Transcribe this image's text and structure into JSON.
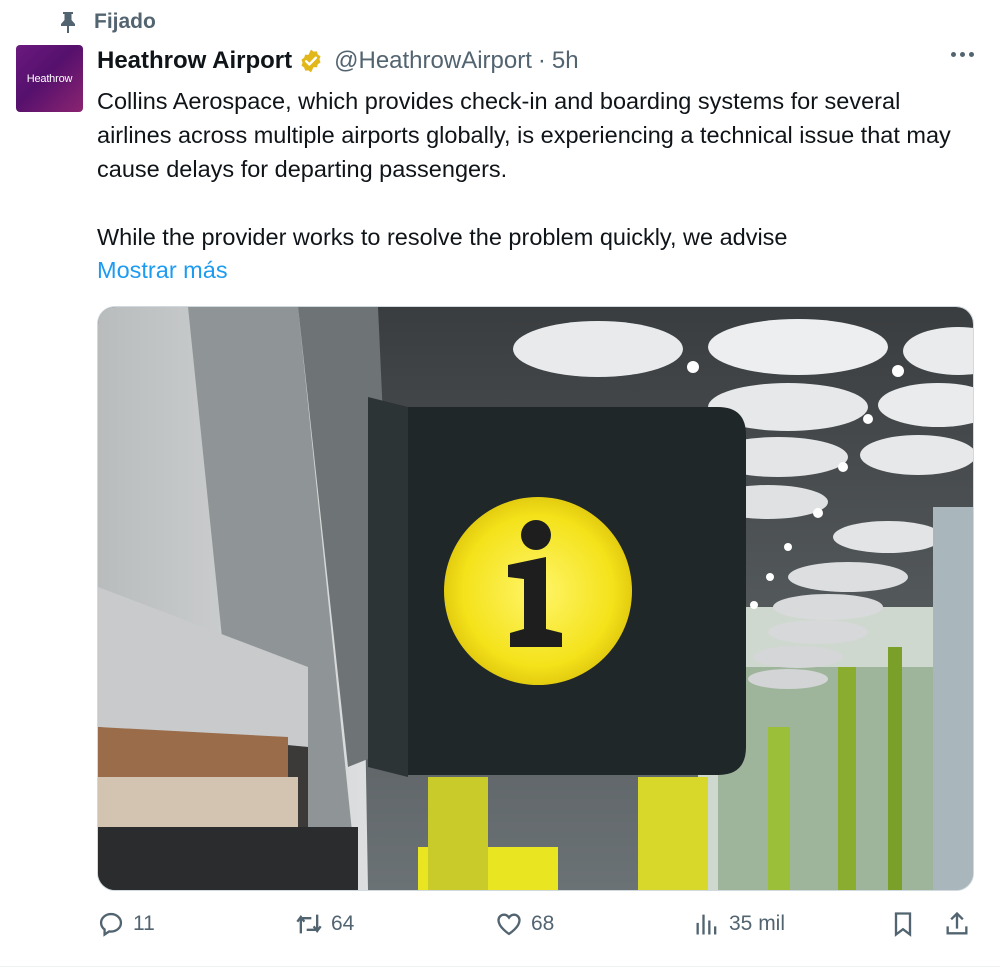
{
  "pinned_label": "Fijado",
  "author": {
    "avatar_text": "Heathrow",
    "name": "Heathrow Airport",
    "handle": "@HeathrowAirport",
    "separator": "·",
    "time": "5h"
  },
  "text": {
    "paragraph1": "Collins Aerospace, which provides check-in and boarding systems for several airlines across multiple airports globally, is experiencing a technical issue that may cause delays for departing passengers.",
    "paragraph2": "While the provider works to resolve the problem quickly, we advise",
    "show_more": "Mostrar más"
  },
  "media": {
    "icon": "information-sign-icon"
  },
  "actions": {
    "replies": "11",
    "reposts": "64",
    "likes": "68",
    "views": "35 mil"
  },
  "colors": {
    "accent": "#1d9bf0",
    "muted": "#536471",
    "verified_gold": "#e2b719",
    "avatar_purple": "#6b1a7e"
  }
}
